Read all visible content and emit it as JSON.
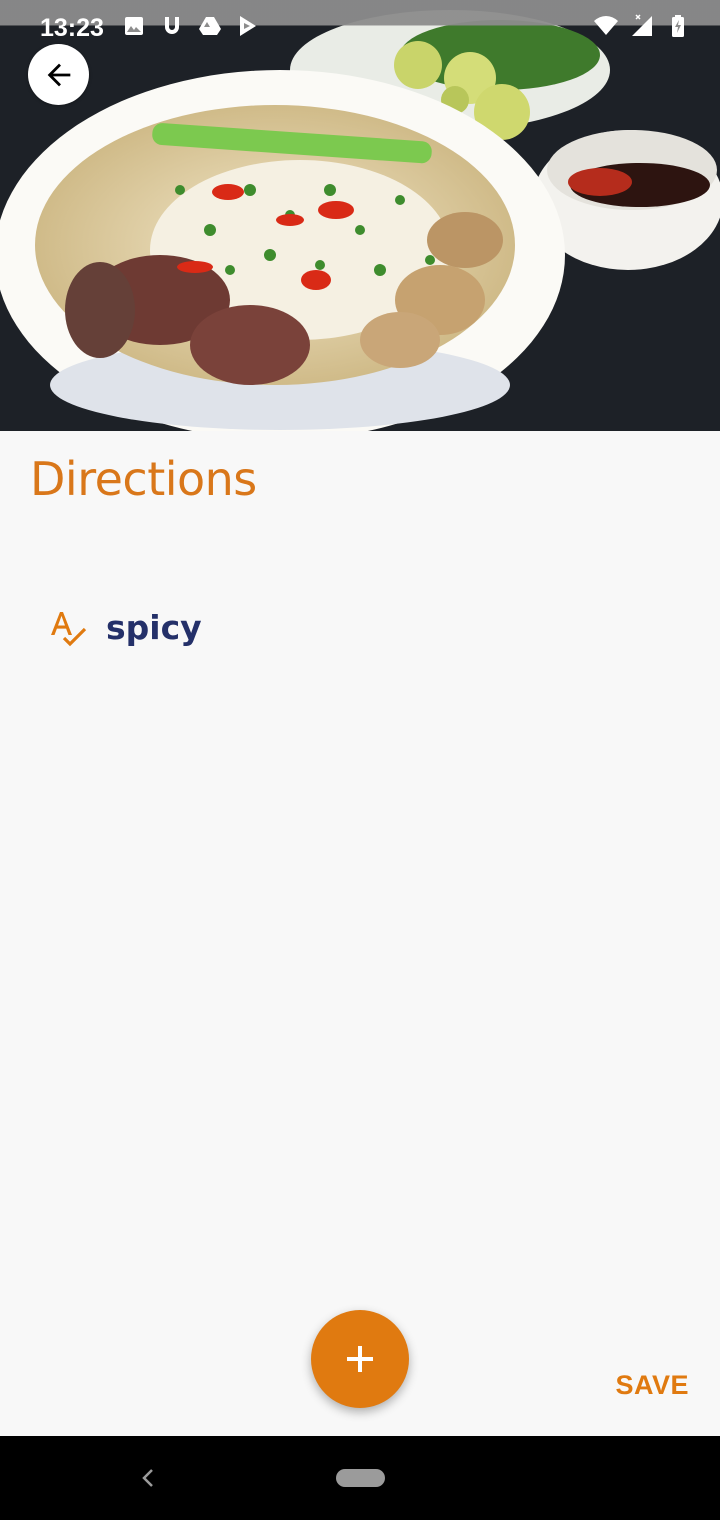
{
  "status_bar": {
    "time": "13:23",
    "left_icons": [
      "image-icon",
      "u-icon",
      "drive-icon",
      "play-store-icon"
    ],
    "right_icons": [
      "wifi-icon",
      "signal-icon",
      "battery-charging-icon"
    ]
  },
  "hero": {
    "image": "pho-noodle-soup-photo"
  },
  "header": {
    "back_icon": "arrow-left-icon"
  },
  "section": {
    "title": "Directions"
  },
  "directions": [
    {
      "icon": "spellcheck-icon",
      "text": "spicy"
    }
  ],
  "actions": {
    "fab_icon": "plus-icon",
    "save_label": "SAVE"
  },
  "nav": {
    "back_icon": "nav-back-icon",
    "home_icon": "nav-home-pill"
  },
  "colors": {
    "accent": "#e07a10",
    "title": "#d9771a",
    "item_text": "#243069",
    "background": "#f8f8f8"
  }
}
